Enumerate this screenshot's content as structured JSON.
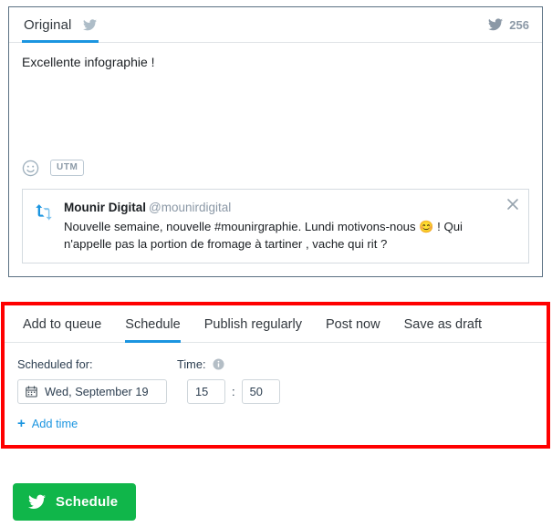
{
  "composer": {
    "tab_label": "Original",
    "tab_icon": "twitter-bird-icon",
    "char_count": "256",
    "counter_icon": "twitter-bird-icon",
    "message_text": "Excellente infographie !",
    "tools": {
      "emoji_icon": "emoji-smiley-icon",
      "utm_label": "UTM"
    },
    "quoted_tweet": {
      "retweet_icon": "retweet-icon",
      "author_name": "Mounir Digital",
      "author_handle": "@mounirdigital",
      "text_line1": "Nouvelle semaine, nouvelle #mounirgraphie. Lundi motivons-nous",
      "emoji": "😊",
      "text_line2": "! Qui n'appelle pas la portion de fromage à tartiner , vache qui rit ?",
      "close_icon": "close-icon"
    }
  },
  "schedule_panel": {
    "highlight_color": "#ff0000",
    "tabs": [
      {
        "label": "Add to queue",
        "active": false
      },
      {
        "label": "Schedule",
        "active": true
      },
      {
        "label": "Publish regularly",
        "active": false
      },
      {
        "label": "Post now",
        "active": false
      },
      {
        "label": "Save as draft",
        "active": false
      }
    ],
    "scheduled_for_label": "Scheduled for:",
    "time_label": "Time:",
    "info_icon": "info-icon",
    "calendar_icon": "calendar-icon",
    "date_value": "Wed, September 19",
    "hour_value": "15",
    "time_separator": ":",
    "minute_value": "50",
    "add_time_label": "Add time",
    "add_time_icon": "plus-icon",
    "accent_color": "#1b95e0"
  },
  "footer": {
    "submit_label": "Schedule",
    "submit_icon": "twitter-bird-icon",
    "submit_color": "#10b64a"
  }
}
